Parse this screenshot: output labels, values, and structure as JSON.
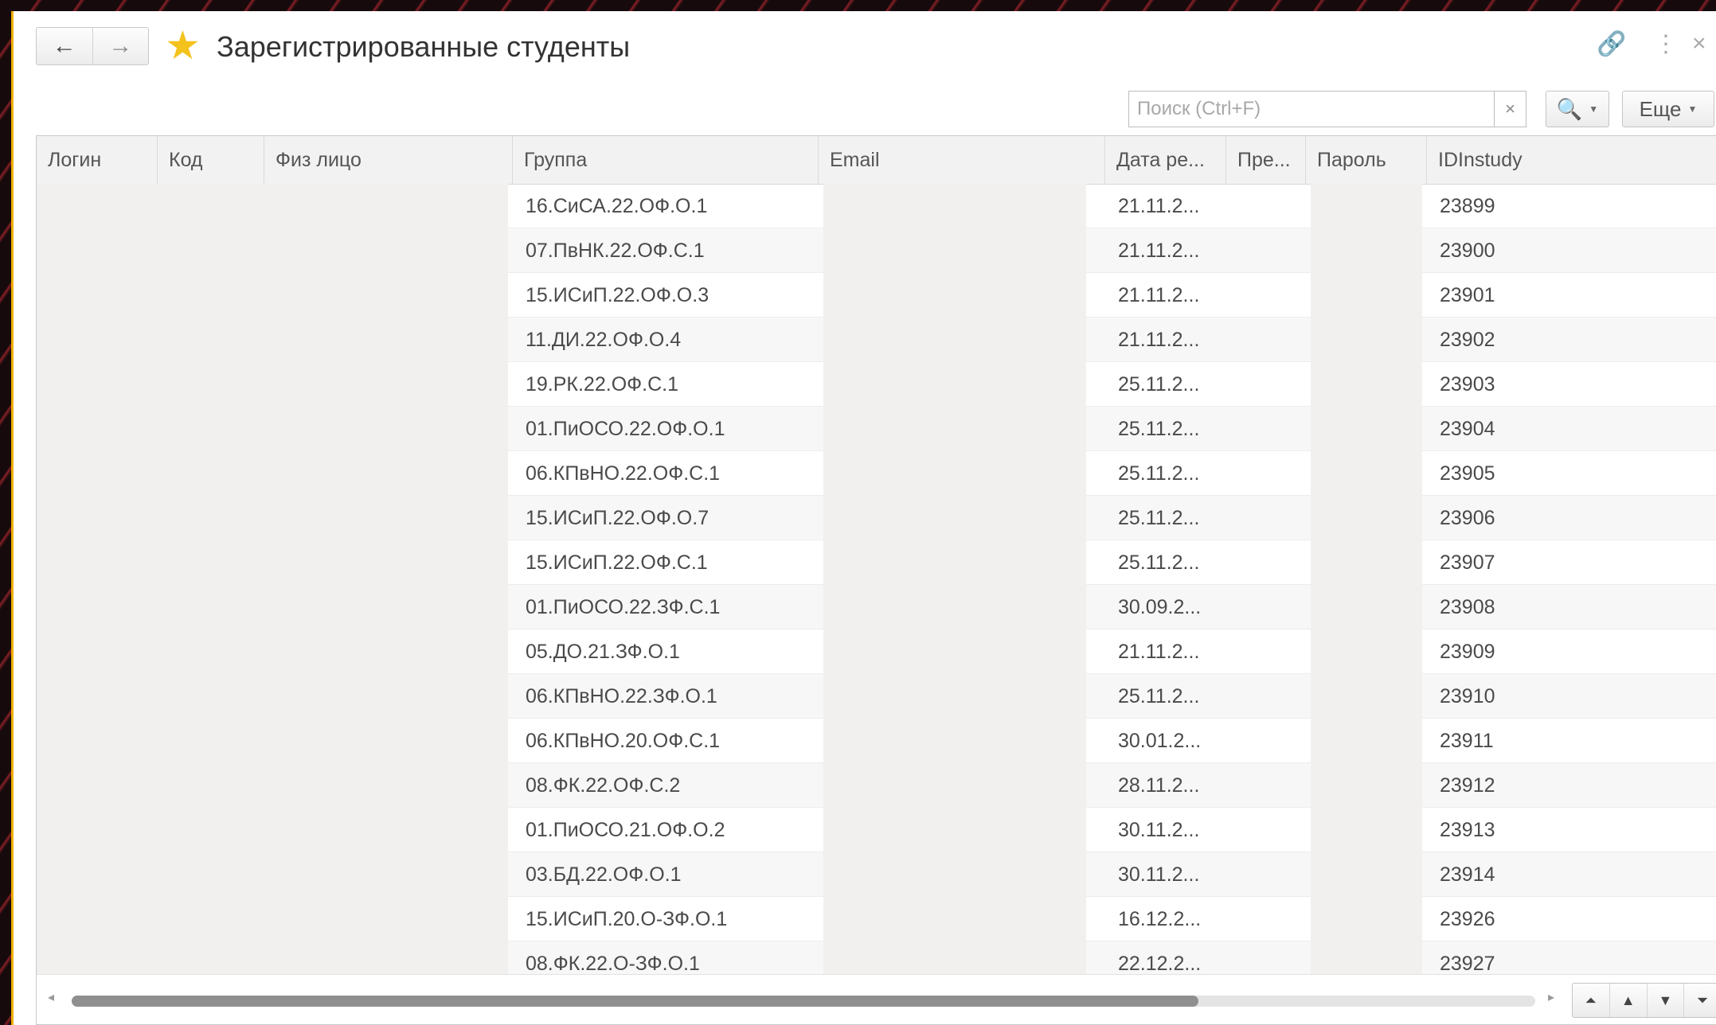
{
  "window": {
    "title": "Зарегистрированные студенты",
    "nav_back": "←",
    "nav_forward": "→",
    "favorite_icon": "★",
    "link_icon": "🔗",
    "more_icon": "⋮",
    "close_icon": "×"
  },
  "toolbar": {
    "search_placeholder": "Поиск (Ctrl+F)",
    "search_clear": "×",
    "search_button_icon": "🔍",
    "more_label": "Еще"
  },
  "table": {
    "columns": [
      "Логин",
      "Код",
      "Физ лицо",
      "Группа",
      "Email",
      "Дата ре...",
      "Пре...",
      "Пароль",
      "IDInstudy"
    ],
    "rows": [
      {
        "group": "16.СиСА.22.ОФ.О.1",
        "date": "21.11.2...",
        "id": "23899"
      },
      {
        "group": "07.ПвНК.22.ОФ.С.1",
        "date": "21.11.2...",
        "id": "23900"
      },
      {
        "group": "15.ИСиП.22.ОФ.О.3",
        "date": "21.11.2...",
        "id": "23901"
      },
      {
        "group": "11.ДИ.22.ОФ.О.4",
        "date": "21.11.2...",
        "id": "23902"
      },
      {
        "group": "19.РК.22.ОФ.С.1",
        "date": "25.11.2...",
        "id": "23903"
      },
      {
        "group": "01.ПиОСО.22.ОФ.О.1",
        "date": "25.11.2...",
        "id": "23904"
      },
      {
        "group": "06.КПвНО.22.ОФ.С.1",
        "date": "25.11.2...",
        "id": "23905"
      },
      {
        "group": "15.ИСиП.22.ОФ.О.7",
        "date": "25.11.2...",
        "id": "23906"
      },
      {
        "group": "15.ИСиП.22.ОФ.С.1",
        "date": "25.11.2...",
        "id": "23907"
      },
      {
        "group": "01.ПиОСО.22.ЗФ.С.1",
        "date": "30.09.2...",
        "id": "23908"
      },
      {
        "group": "05.ДО.21.ЗФ.О.1",
        "date": "21.11.2...",
        "id": "23909"
      },
      {
        "group": "06.КПвНО.22.ЗФ.О.1",
        "date": "25.11.2...",
        "id": "23910"
      },
      {
        "group": "06.КПвНО.20.ОФ.С.1",
        "date": "30.01.2...",
        "id": "23911"
      },
      {
        "group": "08.ФК.22.ОФ.С.2",
        "date": "28.11.2...",
        "id": "23912"
      },
      {
        "group": "01.ПиОСО.21.ОФ.О.2",
        "date": "30.11.2...",
        "id": "23913"
      },
      {
        "group": "03.БД.22.ОФ.О.1",
        "date": "30.11.2...",
        "id": "23914"
      },
      {
        "group": "15.ИСиП.20.О-ЗФ.О.1",
        "date": "16.12.2...",
        "id": "23926"
      },
      {
        "group": "08.ФК.22.О-ЗФ.О.1",
        "date": "22.12.2...",
        "id": "23927"
      }
    ]
  },
  "pager": {
    "first": "⏶",
    "prev": "▲",
    "next": "▼",
    "last": "⏷"
  },
  "scroll": {
    "left_arrow": "◂",
    "right_arrow": "▸",
    "position_fraction": 0.77
  }
}
